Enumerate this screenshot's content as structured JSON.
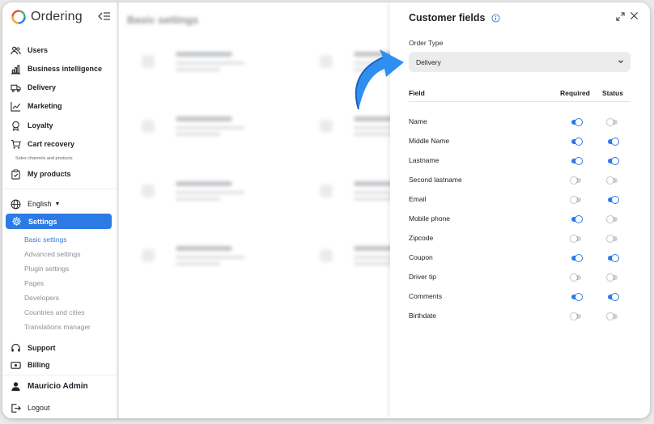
{
  "app": {
    "name": "Ordering"
  },
  "sidebar": {
    "items": [
      {
        "label": "Users",
        "icon": "users-icon"
      },
      {
        "label": "Business intelligence",
        "icon": "bar-chart-icon"
      },
      {
        "label": "Delivery",
        "icon": "truck-icon"
      },
      {
        "label": "Marketing",
        "icon": "trend-icon"
      },
      {
        "label": "Loyalty",
        "icon": "award-icon"
      },
      {
        "label": "Cart recovery",
        "icon": "cart-icon"
      }
    ],
    "section_caption": "Sales channels and products",
    "my_products": "My products",
    "language": "English",
    "settings": "Settings",
    "sub_items": [
      "Basic settings",
      "Advanced settings",
      "Plugin settings",
      "Pages",
      "Developers",
      "Countries and cities",
      "Translations manager"
    ],
    "support": "Support",
    "billing": "Billing",
    "user": "Mauricio Admin",
    "logout": "Logout"
  },
  "background": {
    "title": "Basic settings"
  },
  "panel": {
    "title": "Customer fields",
    "order_type_label": "Order Type",
    "order_type_value": "Delivery",
    "columns": {
      "field": "Field",
      "required": "Required",
      "status": "Status"
    },
    "rows": [
      {
        "name": "Name",
        "required": true,
        "status": false
      },
      {
        "name": "Middle Name",
        "required": true,
        "status": true
      },
      {
        "name": "Lastname",
        "required": true,
        "status": true
      },
      {
        "name": "Second lastname",
        "required": false,
        "status": false
      },
      {
        "name": "Email",
        "required": false,
        "status": true
      },
      {
        "name": "Mobile phone",
        "required": true,
        "status": false
      },
      {
        "name": "Zipcode",
        "required": false,
        "status": false
      },
      {
        "name": "Coupon",
        "required": true,
        "status": true
      },
      {
        "name": "Driver tip",
        "required": false,
        "status": false
      },
      {
        "name": "Comments",
        "required": true,
        "status": true
      },
      {
        "name": "Birthdate",
        "required": false,
        "status": false
      }
    ]
  },
  "colors": {
    "accent": "#2c7be5",
    "toggle_off": "#d0d3d8"
  }
}
